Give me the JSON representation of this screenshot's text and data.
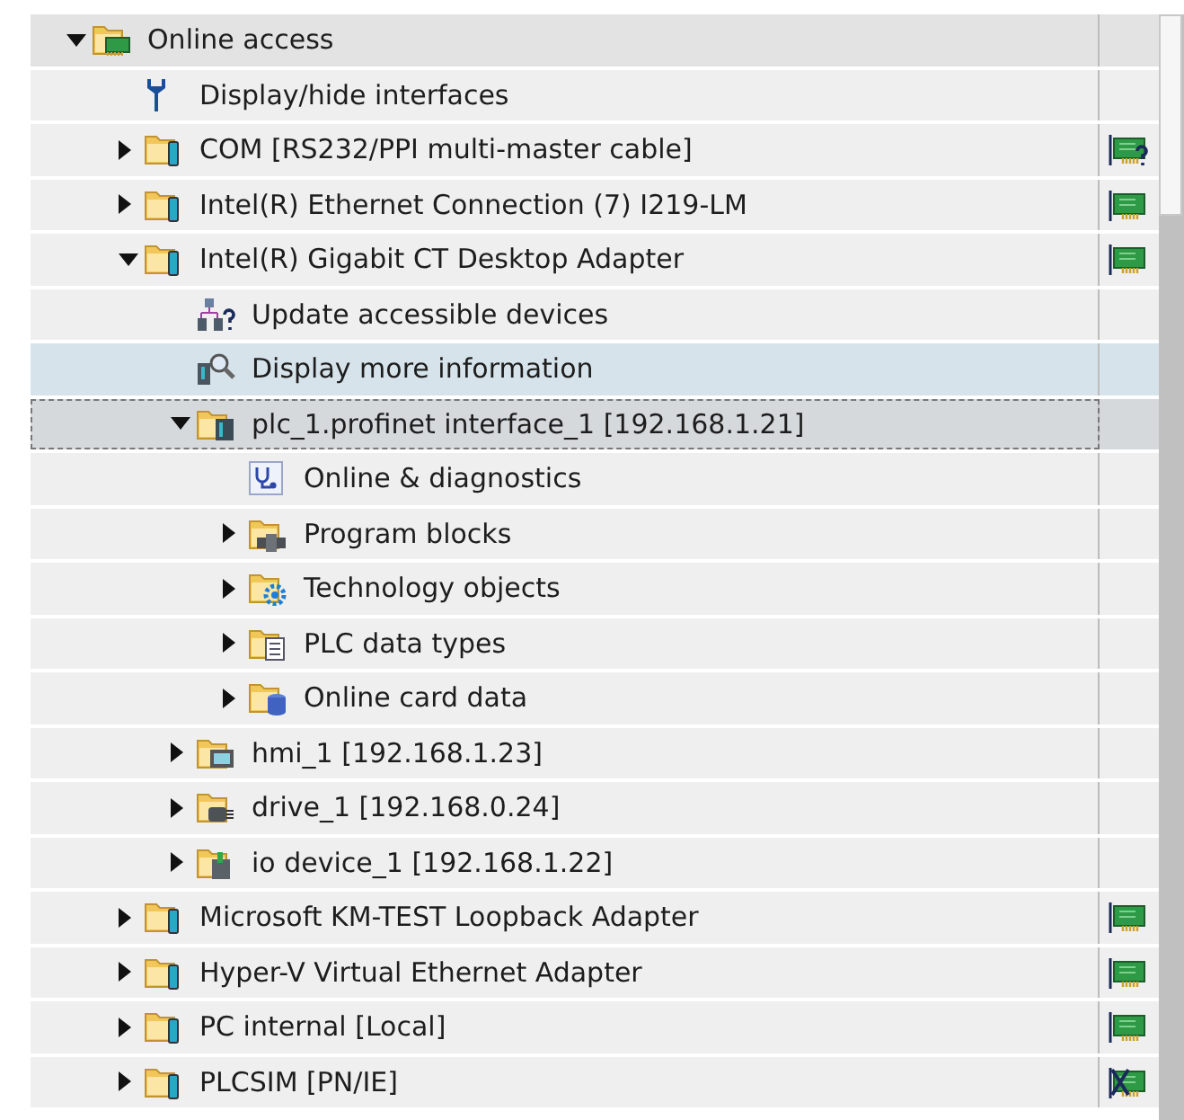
{
  "tree": [
    {
      "label": "Online access",
      "kind": "network",
      "expanded": true,
      "selected": false,
      "highlighted": false,
      "children": [
        {
          "label": "Display/hide interfaces",
          "kind": "tool",
          "selected": false,
          "highlighted": false
        },
        {
          "label": "COM [RS232/PPI multi-master cable]",
          "kind": "interface",
          "expanded": false,
          "selected": false,
          "highlighted": false,
          "status": {
            "kind": "unknown"
          }
        },
        {
          "label": "Intel(R) Ethernet Connection (7) I219-LM",
          "kind": "interface",
          "expanded": false,
          "selected": false,
          "highlighted": false,
          "status": {
            "kind": "ok"
          }
        },
        {
          "label": "Intel(R) Gigabit CT Desktop Adapter",
          "kind": "interface",
          "expanded": true,
          "selected": false,
          "highlighted": false,
          "status": {
            "kind": "ok"
          },
          "children": [
            {
              "label": "Update accessible devices",
              "kind": "update",
              "selected": false,
              "highlighted": false
            },
            {
              "label": "Display more information",
              "kind": "info",
              "selected": false,
              "highlighted": true
            },
            {
              "label": "plc_1.profinet interface_1 [192.168.1.21]",
              "kind": "plc",
              "expanded": true,
              "selected": true,
              "highlighted": false,
              "children": [
                {
                  "label": "Online & diagnostics",
                  "kind": "diagnostics",
                  "selected": false,
                  "highlighted": false
                },
                {
                  "label": "Program blocks",
                  "kind": "blocks",
                  "expanded": false,
                  "selected": false,
                  "highlighted": false
                },
                {
                  "label": "Technology objects",
                  "kind": "technology",
                  "expanded": false,
                  "selected": false,
                  "highlighted": false
                },
                {
                  "label": "PLC data types",
                  "kind": "datatypes",
                  "expanded": false,
                  "selected": false,
                  "highlighted": false
                },
                {
                  "label": "Online card data",
                  "kind": "carddata",
                  "expanded": false,
                  "selected": false,
                  "highlighted": false
                }
              ]
            },
            {
              "label": "hmi_1 [192.168.1.23]",
              "kind": "hmi",
              "expanded": false,
              "selected": false,
              "highlighted": false
            },
            {
              "label": "drive_1 [192.168.0.24]",
              "kind": "drive",
              "expanded": false,
              "selected": false,
              "highlighted": false
            },
            {
              "label": "io device_1 [192.168.1.22]",
              "kind": "iodevice",
              "expanded": false,
              "selected": false,
              "highlighted": false
            }
          ]
        },
        {
          "label": "Microsoft KM-TEST Loopback Adapter",
          "kind": "interface",
          "expanded": false,
          "selected": false,
          "highlighted": false,
          "status": {
            "kind": "ok"
          }
        },
        {
          "label": "Hyper-V Virtual Ethernet Adapter",
          "kind": "interface",
          "expanded": false,
          "selected": false,
          "highlighted": false,
          "status": {
            "kind": "ok"
          }
        },
        {
          "label": "PC internal [Local]",
          "kind": "interface",
          "expanded": false,
          "selected": false,
          "highlighted": false,
          "status": {
            "kind": "ok"
          }
        },
        {
          "label": "PLCSIM [PN/IE]",
          "kind": "interface",
          "expanded": false,
          "selected": false,
          "highlighted": false,
          "status": {
            "kind": "error"
          }
        }
      ]
    }
  ]
}
